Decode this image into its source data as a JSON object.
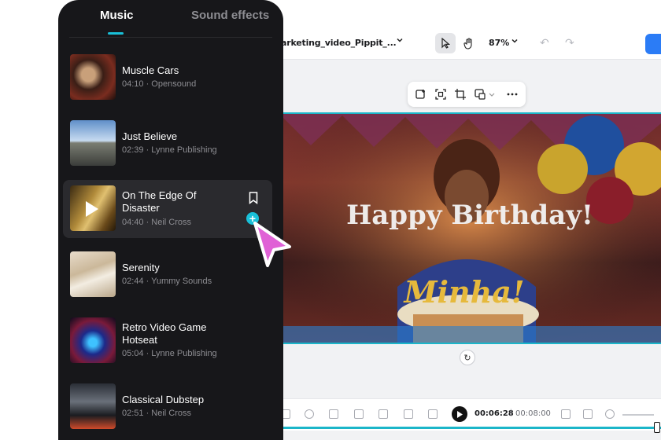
{
  "editor": {
    "filename": "arketing_video_Pippit_...",
    "zoom": "87%",
    "canvas_text": {
      "headline": "Happy Birthday!",
      "name": "Minha!"
    },
    "playback": {
      "current_time": "00:06:28",
      "separator": "|",
      "total_time": "00:08:00"
    }
  },
  "music_panel": {
    "tabs": [
      {
        "label": "Music",
        "active": true
      },
      {
        "label": "Sound effects",
        "active": false
      }
    ],
    "tracks": [
      {
        "title": "Muscle Cars",
        "meta": "04:10 · Opensound"
      },
      {
        "title": "Just Believe",
        "meta": "02:39 · Lynne Publishing"
      },
      {
        "title": "On The Edge Of Disaster",
        "meta": "04:40 · Neil Cross",
        "active": true
      },
      {
        "title": "Serenity",
        "meta": "02:44 · Yummy Sounds"
      },
      {
        "title": "Retro Video Game Hotseat",
        "meta": "05:04 · Lynne Publishing"
      },
      {
        "title": "Classical Dubstep",
        "meta": "02:51 · Neil Cross"
      }
    ]
  },
  "icons": {
    "topbar": [
      "chevron-down-icon",
      "select-cursor-icon",
      "hand-icon",
      "undo-icon",
      "redo-icon"
    ],
    "floating_toolbar": [
      "image-add-icon",
      "focus-icon",
      "crop-icon",
      "replace-image-icon",
      "more-icon"
    ],
    "track_actions": [
      "bookmark-icon",
      "add-icon"
    ]
  },
  "colors": {
    "accent": "#19c0d8",
    "panel_bg": "#17171a",
    "cursor": "#e061d6",
    "export": "#2b7cf6"
  }
}
